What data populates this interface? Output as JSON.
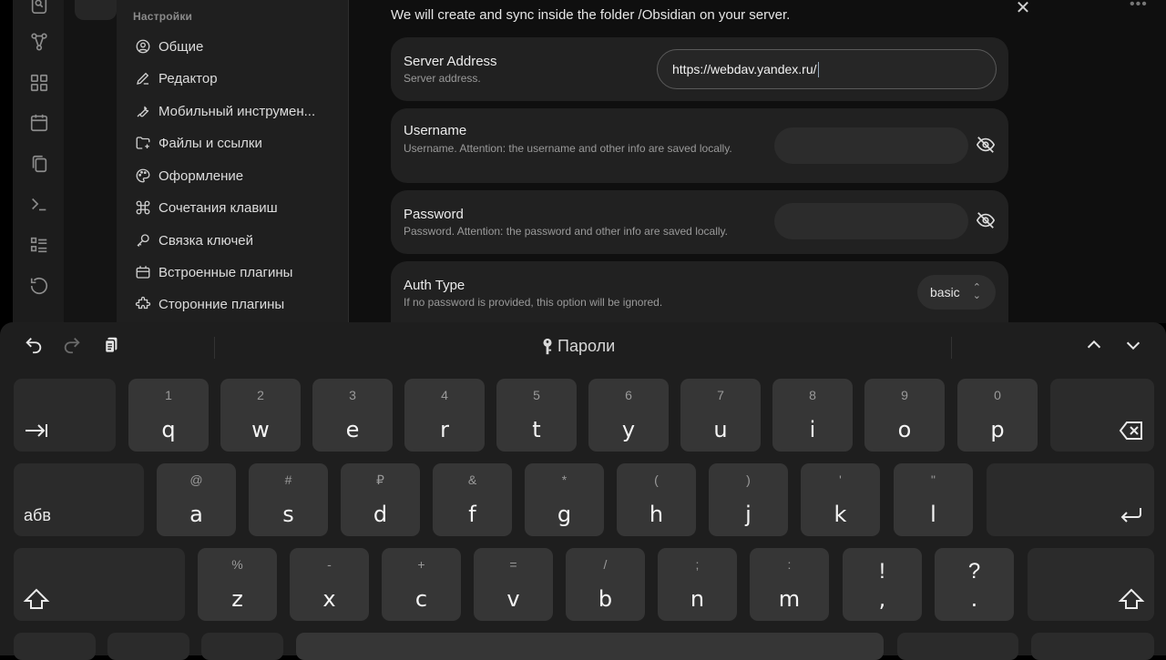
{
  "sidebar": {
    "heading": "Настройки",
    "items": [
      {
        "label": "Общие",
        "icon": "settings-icon"
      },
      {
        "label": "Редактор",
        "icon": "pencil-icon"
      },
      {
        "label": "Мобильный инструмен...",
        "icon": "wrench-icon"
      },
      {
        "label": "Файлы и ссылки",
        "icon": "folder-link-icon"
      },
      {
        "label": "Оформление",
        "icon": "palette-icon"
      },
      {
        "label": "Сочетания клавиш",
        "icon": "command-icon"
      },
      {
        "label": "Связка ключей",
        "icon": "key-icon"
      },
      {
        "label": "Встроенные плагины",
        "icon": "plugin-box-icon"
      },
      {
        "label": "Сторонние плагины",
        "icon": "puzzle-icon"
      }
    ]
  },
  "ribbon": [
    "search-icon",
    "graph-icon",
    "grid-icon",
    "calendar-icon",
    "copy-icon",
    "terminal-icon",
    "list-icon",
    "history-icon"
  ],
  "main": {
    "intro": "We will create and sync inside the folder /Obsidian on your server.",
    "server": {
      "title": "Server Address",
      "desc": "Server address.",
      "value": "https://webdav.yandex.ru/"
    },
    "username": {
      "title": "Username",
      "desc": "Username. Attention: the username and other info are saved locally.",
      "value": ""
    },
    "password": {
      "title": "Password",
      "desc": "Password. Attention: the password and other info are saved locally.",
      "value": ""
    },
    "auth": {
      "title": "Auth Type",
      "desc": "If no password is provided, this option will be ignored.",
      "selected": "basic"
    }
  },
  "keyboard": {
    "bar_title": "Пароли",
    "row1": [
      {
        "main": "q",
        "sec": "1"
      },
      {
        "main": "w",
        "sec": "2"
      },
      {
        "main": "e",
        "sec": "3"
      },
      {
        "main": "r",
        "sec": "4"
      },
      {
        "main": "t",
        "sec": "5"
      },
      {
        "main": "y",
        "sec": "6"
      },
      {
        "main": "u",
        "sec": "7"
      },
      {
        "main": "i",
        "sec": "8"
      },
      {
        "main": "o",
        "sec": "9"
      },
      {
        "main": "p",
        "sec": "0"
      }
    ],
    "row2": [
      {
        "main": "a",
        "sec": "@"
      },
      {
        "main": "s",
        "sec": "#"
      },
      {
        "main": "d",
        "sec": "₽"
      },
      {
        "main": "f",
        "sec": "&"
      },
      {
        "main": "g",
        "sec": "*"
      },
      {
        "main": "h",
        "sec": "("
      },
      {
        "main": "j",
        "sec": ")"
      },
      {
        "main": "k",
        "sec": "'"
      },
      {
        "main": "l",
        "sec": "\""
      }
    ],
    "row3": [
      {
        "main": "z",
        "sec": "%"
      },
      {
        "main": "x",
        "sec": "-"
      },
      {
        "main": "c",
        "sec": "+"
      },
      {
        "main": "v",
        "sec": "="
      },
      {
        "main": "b",
        "sec": "/"
      },
      {
        "main": "n",
        "sec": ";"
      },
      {
        "main": "m",
        "sec": ":"
      },
      {
        "main": ",",
        "sec": "!"
      },
      {
        "main": ".",
        "sec": "?"
      }
    ],
    "lang_label": "абв"
  }
}
